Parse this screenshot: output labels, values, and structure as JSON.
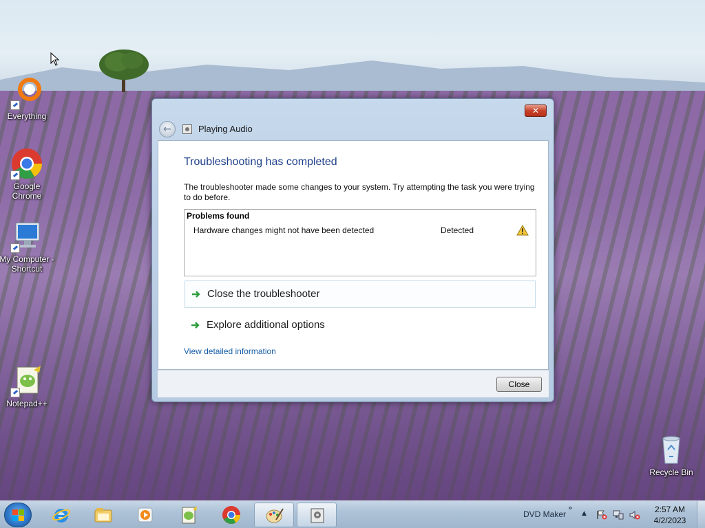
{
  "desktop": {
    "icons": [
      {
        "label": "Everything",
        "icon": "everything-icon"
      },
      {
        "label": "Google Chrome",
        "icon": "chrome-icon"
      },
      {
        "label": "My Computer - Shortcut",
        "icon": "computer-icon"
      },
      {
        "label": "Notepad++",
        "icon": "notepad-plus-plus-icon"
      },
      {
        "label": "Recycle Bin",
        "icon": "recycle-bin-icon"
      }
    ]
  },
  "dialog": {
    "nav_title": "Playing Audio",
    "heading": "Troubleshooting has completed",
    "description": "The troubleshooter made some changes to your system. Try attempting the task you were trying to do before.",
    "problems": {
      "title": "Problems found",
      "rows": [
        {
          "name": "Hardware changes might not have been detected",
          "status": "Detected",
          "icon": "warning-icon"
        }
      ]
    },
    "actions": [
      {
        "label": "Close the troubleshooter"
      },
      {
        "label": "Explore additional options"
      }
    ],
    "link": "View detailed information",
    "close_button": "Close",
    "close_glyph": "✕"
  },
  "taskbar": {
    "pinned": [
      "internet-explorer-icon",
      "file-explorer-icon",
      "media-player-icon",
      "notepad-plus-plus-icon",
      "chrome-icon",
      "paint-icon",
      "troubleshooter-icon"
    ],
    "tray_label": "DVD Maker",
    "chevron": "»",
    "tray_up": "▲",
    "time": "2:57 AM",
    "date": "4/2/2023"
  },
  "colors": {
    "heading": "#1e3f8a",
    "link": "#1b5fa8",
    "action_arrow": "#2f9e3f",
    "close_red": "#c7412a"
  }
}
